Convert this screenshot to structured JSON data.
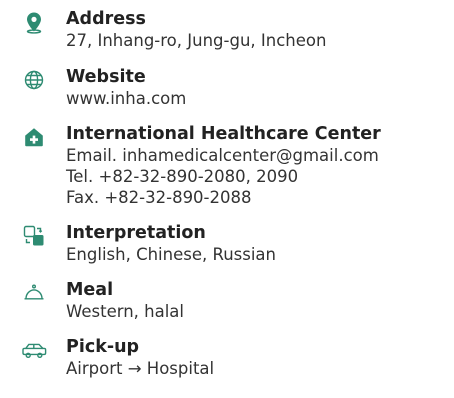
{
  "colors": {
    "accent": "#2e8b72",
    "text": "#222222"
  },
  "items": [
    {
      "icon": "location-pin-icon",
      "label": "Address",
      "lines": [
        "27, Inhang-ro, Jung-gu, Incheon"
      ]
    },
    {
      "icon": "globe-icon",
      "label": "Website",
      "lines": [
        "www.inha.com"
      ]
    },
    {
      "icon": "medical-house-icon",
      "label": "International Healthcare Center",
      "lines": [
        "Email. inhamedicalcenter@gmail.com",
        "Tel. +82-32-890-2080, 2090",
        "Fax. +82-32-890-2088"
      ]
    },
    {
      "icon": "translate-icon",
      "label": "Interpretation",
      "lines": [
        "English, Chinese, Russian"
      ]
    },
    {
      "icon": "meal-cloche-icon",
      "label": "Meal",
      "lines": [
        "Western, halal"
      ]
    },
    {
      "icon": "car-icon",
      "label": "Pick-up",
      "lines": [
        "Airport → Hospital"
      ]
    }
  ]
}
